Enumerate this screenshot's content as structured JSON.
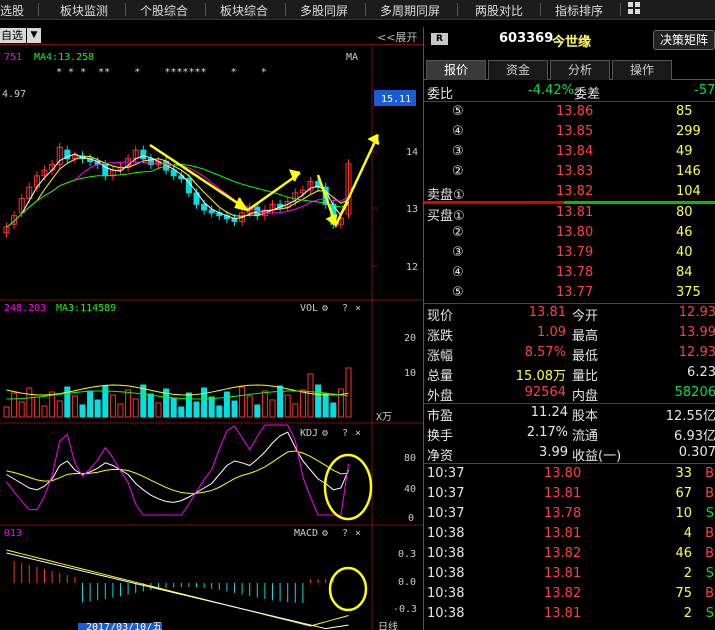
{
  "menu": [
    "选股",
    "板块监测",
    "个股综合",
    "板块综合",
    "多股同屏",
    "多周期同屏",
    "两股对比",
    "指标排序"
  ],
  "chart": {
    "zixuan": "自选",
    "expand": "<<展开",
    "ma_label_num": "751",
    "ma4_label": "MA4:13.258",
    "ma_label": "MA",
    "stars": "* * *  **    *    *******    *    *",
    "high_label": "4.97",
    "price_badge": "15.11",
    "price_ticks": [
      "14",
      "13",
      "12"
    ],
    "vol_label": "248.203",
    "vol_ma3": "MA3:114589",
    "vol_title": "VOL",
    "vol_ticks": [
      "20",
      "10"
    ],
    "vol_unit": "X万",
    "kdj_title": "KDJ",
    "kdj_ticks": [
      "80",
      "40",
      "0"
    ],
    "macd_label": "013",
    "macd_title": "MACD",
    "macd_ticks": [
      "0.3",
      "0.0",
      "-0.3"
    ],
    "date_label": "2017/03/10/五",
    "bottom_right": "日线",
    "panel_icons": {
      "gear": "gear-icon",
      "help": "?",
      "close": "×"
    },
    "colors": {
      "up": "#ff3030",
      "down": "#00e0e0",
      "ma1": "#ffffff",
      "ma2": "#ffff00",
      "ma3": "#ff00ff",
      "ma4": "#00ff00",
      "annot": "#ffff00"
    }
  },
  "quote": {
    "badge": "R",
    "code": "603369",
    "name": "今世缘",
    "matrix_btn": "决策矩阵",
    "tabs": [
      "报价",
      "资金",
      "分析",
      "操作"
    ],
    "weibi_label": "委比",
    "weibi_value": "-4.42%",
    "weicha_label": "委差",
    "weicha_value": "-57",
    "sell_label": "卖盘①",
    "buy_label": "买盘①",
    "asks": [
      {
        "idx": "⑤",
        "price": "13.86",
        "vol": "85"
      },
      {
        "idx": "④",
        "price": "13.85",
        "vol": "299"
      },
      {
        "idx": "③",
        "price": "13.84",
        "vol": "49"
      },
      {
        "idx": "②",
        "price": "13.83",
        "vol": "146"
      },
      {
        "idx": "",
        "price": "13.82",
        "vol": "104"
      }
    ],
    "bids": [
      {
        "idx": "",
        "price": "13.81",
        "vol": "80"
      },
      {
        "idx": "②",
        "price": "13.80",
        "vol": "46"
      },
      {
        "idx": "③",
        "price": "13.79",
        "vol": "40"
      },
      {
        "idx": "④",
        "price": "13.78",
        "vol": "84"
      },
      {
        "idx": "⑤",
        "price": "13.77",
        "vol": "375"
      }
    ],
    "stats1": [
      {
        "l1": "现价",
        "v1": "13.81",
        "c1": "red",
        "l2": "今开",
        "v2": "12.93",
        "c2": "red"
      },
      {
        "l1": "涨跌",
        "v1": "1.09",
        "c1": "red",
        "l2": "最高",
        "v2": "13.99",
        "c2": "red"
      },
      {
        "l1": "涨幅",
        "v1": "8.57%",
        "c1": "red",
        "l2": "最低",
        "v2": "12.93",
        "c2": "red"
      },
      {
        "l1": "总量",
        "v1": "15.08万",
        "c1": "yellow",
        "l2": "量比",
        "v2": "6.23",
        "c2": "white"
      },
      {
        "l1": "外盘",
        "v1": "92564",
        "c1": "red",
        "l2": "内盘",
        "v2": "58206",
        "c2": "green"
      }
    ],
    "stats2": [
      {
        "l1": "市盈",
        "v1": "11.24",
        "l2": "股本",
        "v2": "12.55亿"
      },
      {
        "l1": "换手",
        "v1": "2.17%",
        "l2": "流通",
        "v2": "6.93亿"
      },
      {
        "l1": "净资",
        "v1": "3.99",
        "l2": "收益(一)",
        "v2": "0.307"
      }
    ],
    "ticks": [
      {
        "time": "10:37",
        "price": "13.80",
        "vol": "33",
        "side": "B"
      },
      {
        "time": "10:37",
        "price": "13.81",
        "vol": "67",
        "side": "B"
      },
      {
        "time": "10:37",
        "price": "13.78",
        "vol": "10",
        "side": "S"
      },
      {
        "time": "10:38",
        "price": "13.81",
        "vol": "4",
        "side": "B"
      },
      {
        "time": "10:38",
        "price": "13.82",
        "vol": "46",
        "side": "B"
      },
      {
        "time": "10:38",
        "price": "13.81",
        "vol": "2",
        "side": "S"
      },
      {
        "time": "10:38",
        "price": "13.82",
        "vol": "75",
        "side": "B"
      },
      {
        "time": "10:38",
        "price": "13.81",
        "vol": "2",
        "side": "S"
      }
    ]
  }
}
